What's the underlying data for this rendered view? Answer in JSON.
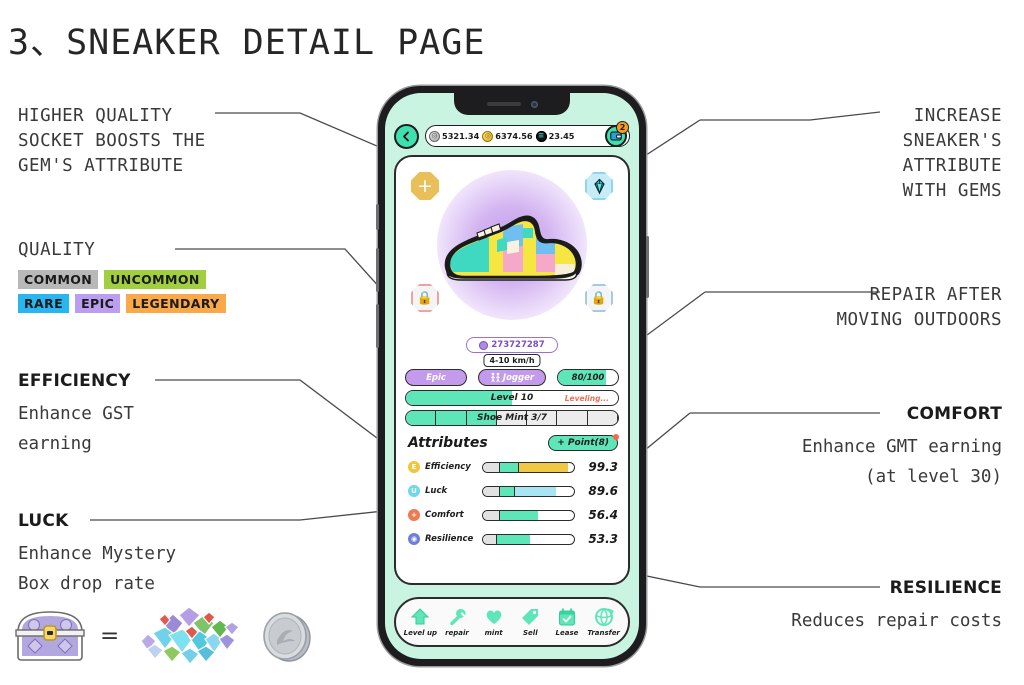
{
  "title": "3、SNEAKER DETAIL PAGE",
  "annotations": {
    "socket": "HIGHER QUALITY\nSOCKET BOOSTS THE\nGEM'S ATTRIBUTE",
    "quality_label": "QUALITY",
    "quality_badges": [
      {
        "label": "COMMON",
        "color": "#b8b8b8"
      },
      {
        "label": "UNCOMMON",
        "color": "#a0d040"
      },
      {
        "label": "RARE",
        "color": "#29b6f0"
      },
      {
        "label": "EPIC",
        "color": "#bb9ef0"
      },
      {
        "label": "LEGENDARY",
        "color": "#f9a94a"
      }
    ],
    "efficiency": {
      "head": "EFFICIENCY",
      "body": "Enhance GST\nearning"
    },
    "luck": {
      "head": "LUCK",
      "body": "Enhance Mystery\nBox drop rate"
    },
    "increase": "INCREASE\nSNEAKER'S\nATTRIBUTE\nWITH GEMS",
    "repair": "REPAIR AFTER\nMOVING OUTDOORS",
    "comfort": {
      "head": "COMFORT",
      "body": "Enhance GMT earning\n(at level 30)"
    },
    "resilience": {
      "head": "RESILIENCE",
      "body": "Reduces repair costs"
    },
    "equals": "="
  },
  "phone": {
    "topbar": {
      "back_icon": "chevron-left-icon",
      "balances": [
        {
          "icon": "gst-coin-icon",
          "value": "5321.34"
        },
        {
          "icon": "gmt-coin-icon",
          "value": "6374.56"
        },
        {
          "icon": "solana-coin-icon",
          "value": "23.45"
        }
      ],
      "wallet_icon": "wallet-icon",
      "wallet_badge": "2"
    },
    "sockets": [
      {
        "name": "socket-empty-top-left",
        "state": "empty",
        "glyph": "+"
      },
      {
        "name": "socket-gem-top-right",
        "state": "gem",
        "glyph": "◆"
      },
      {
        "name": "socket-locked-bottom-left",
        "state": "locked",
        "glyph": "🔒"
      },
      {
        "name": "socket-locked-bottom-right",
        "state": "locked",
        "glyph": "🔒"
      }
    ],
    "shoe_id": "273727287",
    "speed": "4-10 km/h",
    "quality": "Epic",
    "type": "Jogger",
    "durability": "80/100",
    "durability_pct": 80,
    "level": "Level 10",
    "level_pct": 50,
    "level_status": "Leveling...",
    "mint": "Shoe Mint 3/7",
    "mint_used": 3,
    "mint_total": 7,
    "attributes_title": "Attributes",
    "point_button": "+ Point(8)",
    "attributes": [
      {
        "name": "Efficiency",
        "value": "99.3",
        "icon": "efficiency-icon",
        "icon_glyph": "E",
        "icon_color": "#f2c53d",
        "base_pct": 18,
        "mid_pct": 20,
        "top_pct": 55,
        "top_color": "#f0c843"
      },
      {
        "name": "Luck",
        "value": "89.6",
        "icon": "luck-icon",
        "icon_glyph": "U",
        "icon_color": "#6fd8ea",
        "base_pct": 18,
        "mid_pct": 16,
        "top_pct": 46,
        "top_color": "#a8e4f2"
      },
      {
        "name": "Comfort",
        "value": "56.4",
        "icon": "comfort-icon",
        "icon_glyph": "+",
        "icon_color": "#ef7a52",
        "base_pct": 18,
        "mid_pct": 42,
        "top_pct": 0,
        "top_color": "#5fe6b8"
      },
      {
        "name": "Resilience",
        "value": "53.3",
        "icon": "resilience-icon",
        "icon_glyph": "◉",
        "icon_color": "#6f7fd8",
        "base_pct": 14,
        "mid_pct": 38,
        "top_pct": 0,
        "top_color": "#5fe6b8"
      }
    ],
    "bottom_nav": [
      {
        "label": "Level up",
        "icon": "arrow-up-icon"
      },
      {
        "label": "repair",
        "icon": "wrench-icon"
      },
      {
        "label": "mint",
        "icon": "heart-icon"
      },
      {
        "label": "Sell",
        "icon": "tag-icon"
      },
      {
        "label": "Lease",
        "icon": "calendar-icon"
      },
      {
        "label": "Transfer",
        "icon": "globe-refresh-icon"
      }
    ]
  },
  "colors": {
    "mint": "#c9f4e2",
    "accent": "#5fe6b8",
    "frame": "#1d1d1f",
    "epic": "#c49bec"
  }
}
